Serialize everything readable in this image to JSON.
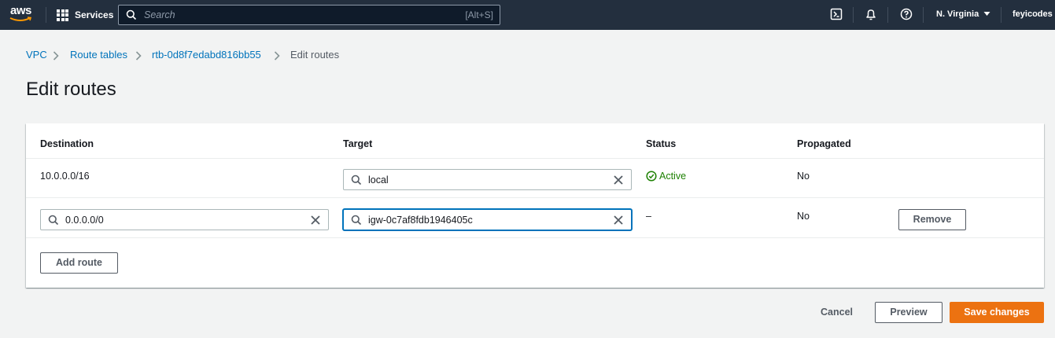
{
  "nav": {
    "logo": "aws",
    "services": "Services",
    "search_placeholder": "Search",
    "search_shortcut": "[Alt+S]",
    "region": "N. Virginia",
    "user": "feyicodes"
  },
  "breadcrumb": {
    "items": [
      "VPC",
      "Route tables",
      "rtb-0d8f7edabd816bb55"
    ],
    "current": "Edit routes"
  },
  "page_title": "Edit routes",
  "table": {
    "headers": [
      "Destination",
      "Target",
      "Status",
      "Propagated"
    ],
    "rows": [
      {
        "destination": "10.0.0.0/16",
        "target": "local",
        "status": "Active",
        "propagated": "No"
      },
      {
        "destination": "0.0.0.0/0",
        "target": "igw-0c7af8fdb1946405c",
        "status": "–",
        "propagated": "No",
        "remove": "Remove"
      }
    ]
  },
  "add_route": "Add route",
  "footer": {
    "cancel": "Cancel",
    "preview": "Preview",
    "save": "Save changes"
  },
  "colors": {
    "topbar": "#232f3e",
    "link": "#0073bb",
    "primary": "#ec7211",
    "success": "#1d8102"
  },
  "icons": [
    "grid-icon",
    "search-icon",
    "cloudshell-icon",
    "bell-icon",
    "help-icon",
    "caret-down-icon",
    "chevron-right-icon",
    "clear-icon",
    "check-circle-icon"
  ]
}
